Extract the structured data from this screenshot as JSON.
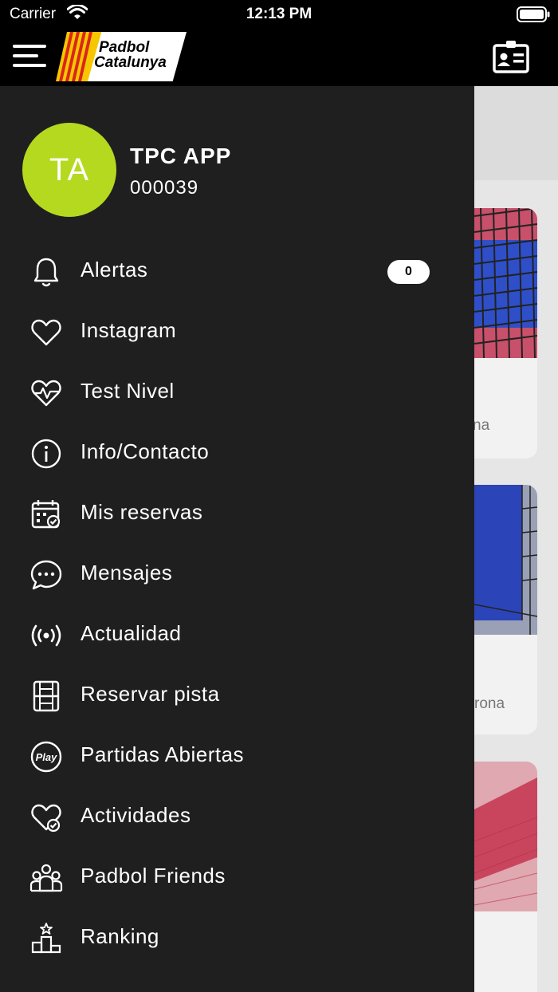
{
  "status_bar": {
    "carrier": "Carrier",
    "time": "12:13 PM"
  },
  "header": {
    "logo_line1": "Padbol",
    "logo_line2": "Catalunya",
    "colors": {
      "stripe_red": "#d9261c",
      "stripe_yellow": "#f6c700"
    }
  },
  "user": {
    "initials": "TA",
    "name": "TPC APP",
    "id": "000039",
    "avatar_color": "#b5d91f"
  },
  "menu": {
    "items": [
      {
        "label": "Alertas",
        "icon": "bell-icon",
        "badge": "0"
      },
      {
        "label": "Instagram",
        "icon": "heart-icon"
      },
      {
        "label": "Test Nivel",
        "icon": "heart-pulse-icon"
      },
      {
        "label": "Info/Contacto",
        "icon": "info-icon"
      },
      {
        "label": "Mis reservas",
        "icon": "calendar-check-icon"
      },
      {
        "label": "Mensajes",
        "icon": "chat-bubble-icon"
      },
      {
        "label": "Actualidad",
        "icon": "broadcast-icon"
      },
      {
        "label": "Reservar pista",
        "icon": "court-icon"
      },
      {
        "label": "Partidas Abiertas",
        "icon": "play-badge-icon"
      },
      {
        "label": "Actividades",
        "icon": "heart-check-icon"
      },
      {
        "label": "Padbol Friends",
        "icon": "group-icon"
      },
      {
        "label": "Ranking",
        "icon": "podium-icon"
      }
    ]
  },
  "background": {
    "card1_text": "na",
    "card2_text": "rona"
  }
}
